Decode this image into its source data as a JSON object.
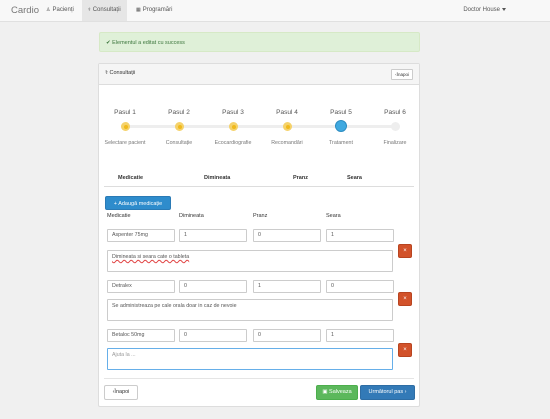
{
  "navbar": {
    "brand": "Cardio",
    "items": [
      {
        "icon": "person-icon",
        "label": "Pacienți"
      },
      {
        "icon": "stethoscope-icon",
        "label": "Consultații"
      },
      {
        "icon": "calendar-icon",
        "label": "Programări"
      }
    ],
    "user": "Doctor House"
  },
  "alert": {
    "text": "Elementul a editat cu success",
    "color": "#3c763d"
  },
  "panel": {
    "title": "Consultații",
    "back_small": "Înapoi"
  },
  "wizard": {
    "steps": [
      {
        "title": "Pasul 1",
        "label": "Selectare pacient",
        "state": "done"
      },
      {
        "title": "Pasul 2",
        "label": "Consultație",
        "state": "done"
      },
      {
        "title": "Pasul 3",
        "label": "Ecocardiografie",
        "state": "done"
      },
      {
        "title": "Pasul 4",
        "label": "Recomandări",
        "state": "done"
      },
      {
        "title": "Pasul 5",
        "label": "Tratament",
        "state": "current"
      },
      {
        "title": "Pasul 6",
        "label": "Finalizare",
        "state": "future"
      }
    ]
  },
  "table_head": {
    "medicatie": "Medicatie",
    "dimineata": "Dimineata",
    "pranz": "Pranz",
    "seara": "Seara"
  },
  "add_button": "Adaugă medicație",
  "columns": {
    "medicatie": "Medicatie",
    "dimineata": "Dimineata",
    "pranz": "Pranz",
    "seara": "Seara"
  },
  "medications": [
    {
      "name": "Aspenter 75mg",
      "dimineata": "1",
      "pranz": "0",
      "seara": "1",
      "note": "Dimineata si seara cate o tableta",
      "placeholder": ""
    },
    {
      "name": "Detralex",
      "dimineata": "0",
      "pranz": "1",
      "seara": "0",
      "note": "Se administreaza pe cale orala doar in caz de nevoie",
      "placeholder": ""
    },
    {
      "name": "Betaloc 50mg",
      "dimineata": "0",
      "pranz": "0",
      "seara": "1",
      "note": "",
      "placeholder": "Ajuta la ..."
    }
  ],
  "delete_label": "×",
  "footer": {
    "prev": "Înapoi",
    "save": "Salveaza",
    "next": "Următorul pas"
  },
  "colors": {
    "primary": "#337ab7",
    "success": "#5cb85c",
    "danger": "#d2522a",
    "step_done": "#f0b91c",
    "step_current": "#3fa9e0"
  }
}
